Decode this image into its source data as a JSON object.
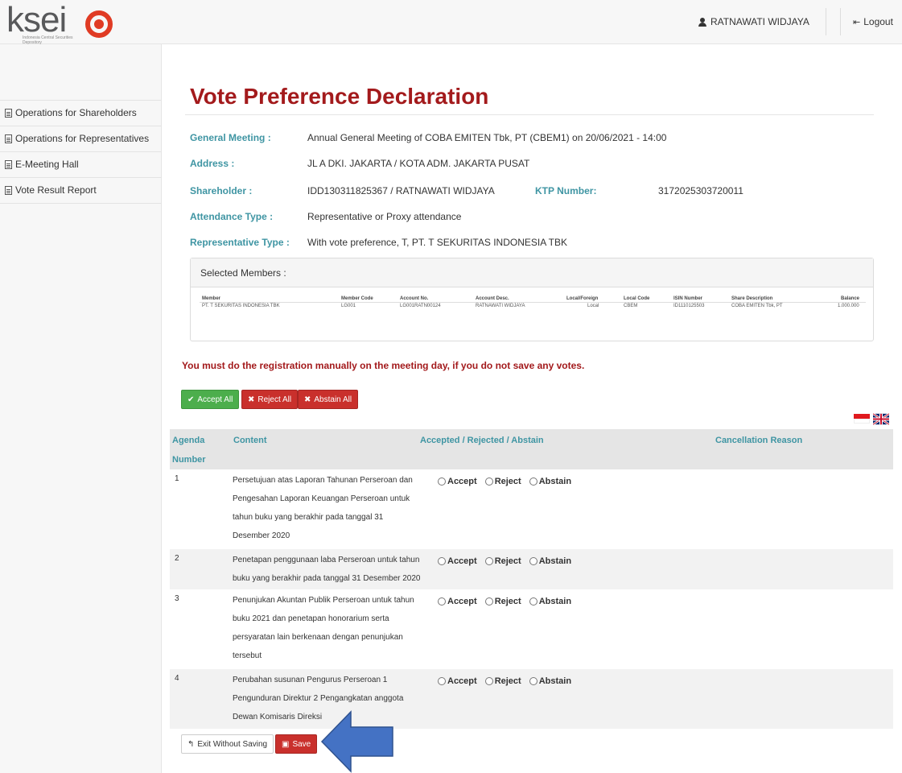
{
  "header": {
    "logo_text": "ksei",
    "logo_subtext": "Indonesia Central Securities Depository",
    "user_name": "RATNAWATI WIDJAYA",
    "logout_label": "Logout"
  },
  "sidebar": {
    "items": [
      {
        "label": "Operations for Shareholders"
      },
      {
        "label": "Operations for Representatives"
      },
      {
        "label": "E-Meeting Hall"
      },
      {
        "label": "Vote Result Report"
      }
    ]
  },
  "page": {
    "title": "Vote Preference Declaration",
    "info": {
      "general_meeting_label": "General Meeting :",
      "general_meeting_value": "Annual General Meeting of COBA EMITEN Tbk, PT (CBEM1) on 20/06/2021 - 14:00",
      "address_label": "Address :",
      "address_value": "JL A DKI. JAKARTA / KOTA ADM. JAKARTA PUSAT",
      "shareholder_label": "Shareholder :",
      "shareholder_value": "IDD130311825367 / RATNAWATI WIDJAYA",
      "ktp_label": "KTP Number:",
      "ktp_value": "3172025303720011",
      "attendance_label": "Attendance Type :",
      "attendance_value": "Representative or Proxy attendance",
      "rep_type_label": "Representative Type :",
      "rep_type_value": "With vote preference, T, PT. T SEKURITAS INDONESIA TBK"
    },
    "members": {
      "title": "Selected Members :",
      "headers": [
        "Member",
        "Member Code",
        "Account No.",
        "Account Desc.",
        "Local/Foreign",
        "Local Code",
        "ISIN Number",
        "Share Description",
        "Balance"
      ],
      "row": [
        "PT. T SEKURITAS INDONESIA TBK",
        "LG001",
        "LG001RATN00124",
        "RATNAWATI WIDJAYA",
        "Local",
        "CBEM",
        "ID1110125503",
        "COBA EMITEN Tbk, PT",
        "1.000.000"
      ]
    },
    "warning": "You must do the registration manually on the meeting day, if you do not save any votes.",
    "buttons": {
      "accept_all": "Accept All",
      "reject_all": "Reject All",
      "abstain_all": "Abstain All",
      "exit": "Exit Without Saving",
      "save": "Save"
    },
    "vote_table": {
      "headers": {
        "agenda_line1": "Agenda",
        "agenda_line2": "Number",
        "content": "Content",
        "choice": "Accepted / Rejected / Abstain",
        "reason": "Cancellation Reason"
      },
      "options": [
        "Accept",
        "Reject",
        "Abstain"
      ],
      "rows": [
        {
          "num": "1",
          "lines": [
            "Persetujuan atas Laporan Tahunan Perseroan dan",
            "Pengesahan Laporan Keuangan Perseroan untuk",
            "tahun buku yang berakhir pada tanggal 31",
            "Desember 2020"
          ]
        },
        {
          "num": "2",
          "lines": [
            "Penetapan penggunaan laba Perseroan untuk tahun",
            "buku yang berakhir pada tanggal 31 Desember 2020"
          ]
        },
        {
          "num": "3",
          "lines": [
            "Penunjukan Akuntan Publik Perseroan untuk tahun",
            "buku 2021 dan penetapan honorarium serta",
            "persyaratan lain berkenaan dengan penunjukan",
            "tersebut"
          ]
        },
        {
          "num": "4",
          "lines": [
            "Perubahan susunan Pengurus Perseroan 1",
            "Pengunduran Direktur 2 Pengangkatan anggota",
            "Dewan Komisaris Direksi"
          ]
        }
      ]
    }
  },
  "colors": {
    "brand_red": "#a31a1c",
    "label_teal": "#3f95a3",
    "accept_green": "#4cae4c",
    "arrow_blue": "#4472c4"
  }
}
